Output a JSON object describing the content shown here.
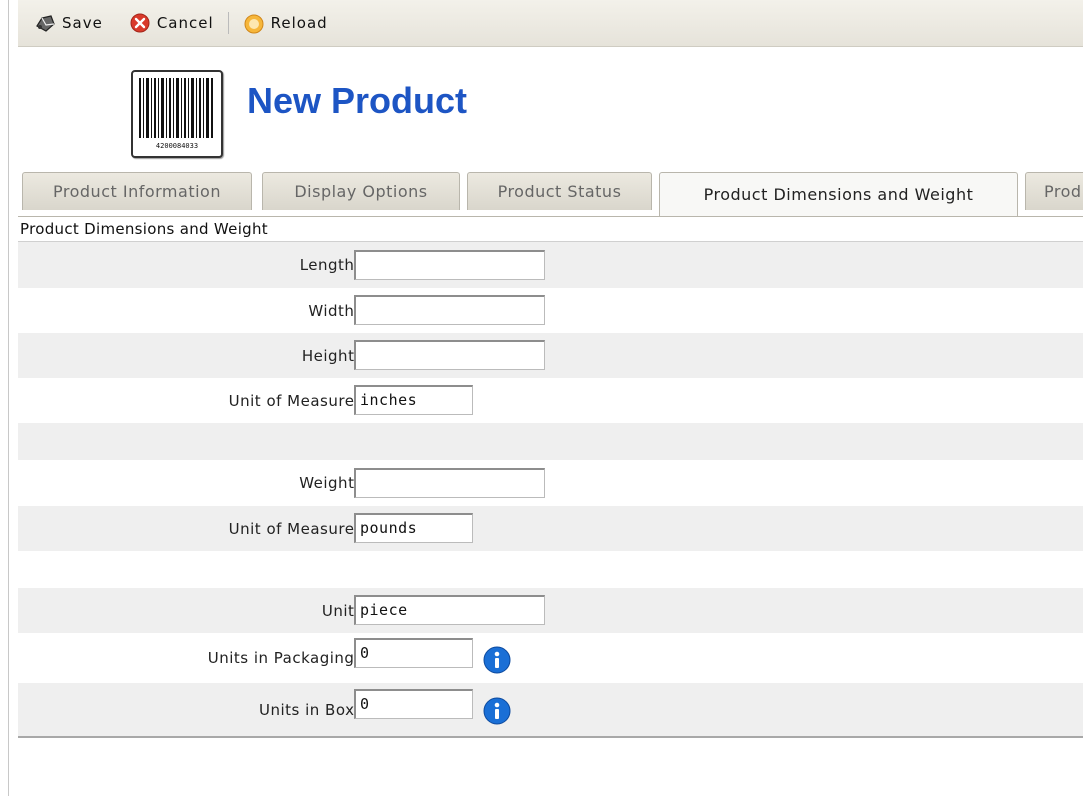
{
  "toolbar": {
    "save_label": "Save",
    "cancel_label": "Cancel",
    "reload_label": "Reload"
  },
  "header": {
    "title": "New Product",
    "barcode_digits": "4200084033"
  },
  "tabs": [
    {
      "label": "Product Information"
    },
    {
      "label": "Display Options"
    },
    {
      "label": "Product Status"
    },
    {
      "label": "Product Dimensions and Weight",
      "active": true
    },
    {
      "label": "Prod"
    }
  ],
  "panel": {
    "heading": "Product Dimensions and Weight",
    "length_label": "Length:",
    "length_value": "",
    "width_label": "Width:",
    "width_value": "",
    "height_label": "Height:",
    "height_value": "",
    "dim_unit_label": "Unit of Measure:",
    "dim_unit_value": "inches",
    "weight_label": "Weight:",
    "weight_value": "",
    "weight_unit_label": "Unit of Measure:",
    "weight_unit_value": "pounds",
    "unit_label": "Unit:",
    "unit_value": "piece",
    "units_packaging_label": "Units in Packaging:",
    "units_packaging_value": "0",
    "units_box_label": "Units in Box:",
    "units_box_value": "0"
  },
  "icons": [
    "save-icon",
    "cancel-icon",
    "reload-icon",
    "barcode-icon",
    "info-icon"
  ],
  "colors": {
    "title": "#1d55c4",
    "info": "#1a6fd6",
    "cancel": "#d93a2b",
    "reload": "#f0a020"
  }
}
